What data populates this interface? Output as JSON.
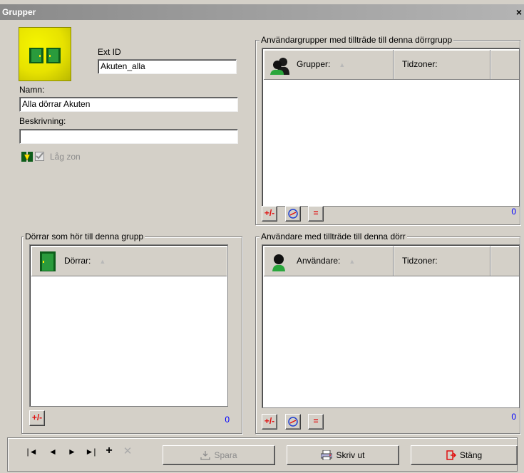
{
  "window": {
    "title": "Grupper",
    "close_glyph": "×"
  },
  "form": {
    "ext_id_label": "Ext ID",
    "ext_id_value": "Akuten_alla",
    "name_label": "Namn:",
    "name_value": "Alla dörrar Akuten",
    "description_label": "Beskrivning:",
    "description_value": "",
    "low_zone_label": "Låg zon",
    "low_zone_checked": true
  },
  "user_groups": {
    "title": "Användargrupper med tillträde till denna dörrgrupp",
    "columns": [
      "Grupper:",
      "Tidzoner:"
    ],
    "rows": [],
    "count": "0",
    "buttons": [
      "+/-",
      "⊘",
      "="
    ]
  },
  "doors": {
    "title": "Dörrar som hör till denna grupp",
    "columns": [
      "Dörrar:"
    ],
    "rows": [],
    "count": "0",
    "buttons": [
      "+/-"
    ]
  },
  "users": {
    "title": "Användare med tillträde till denna dörr",
    "columns": [
      "Användare:",
      "Tidzoner:"
    ],
    "rows": [],
    "count": "0",
    "buttons": [
      "+/-",
      "⊘",
      "="
    ]
  },
  "footer": {
    "nav": [
      "first",
      "prev",
      "next",
      "last",
      "add",
      "delete"
    ],
    "save_label": "Spara",
    "print_label": "Skriv ut",
    "close_label": "Stäng"
  }
}
